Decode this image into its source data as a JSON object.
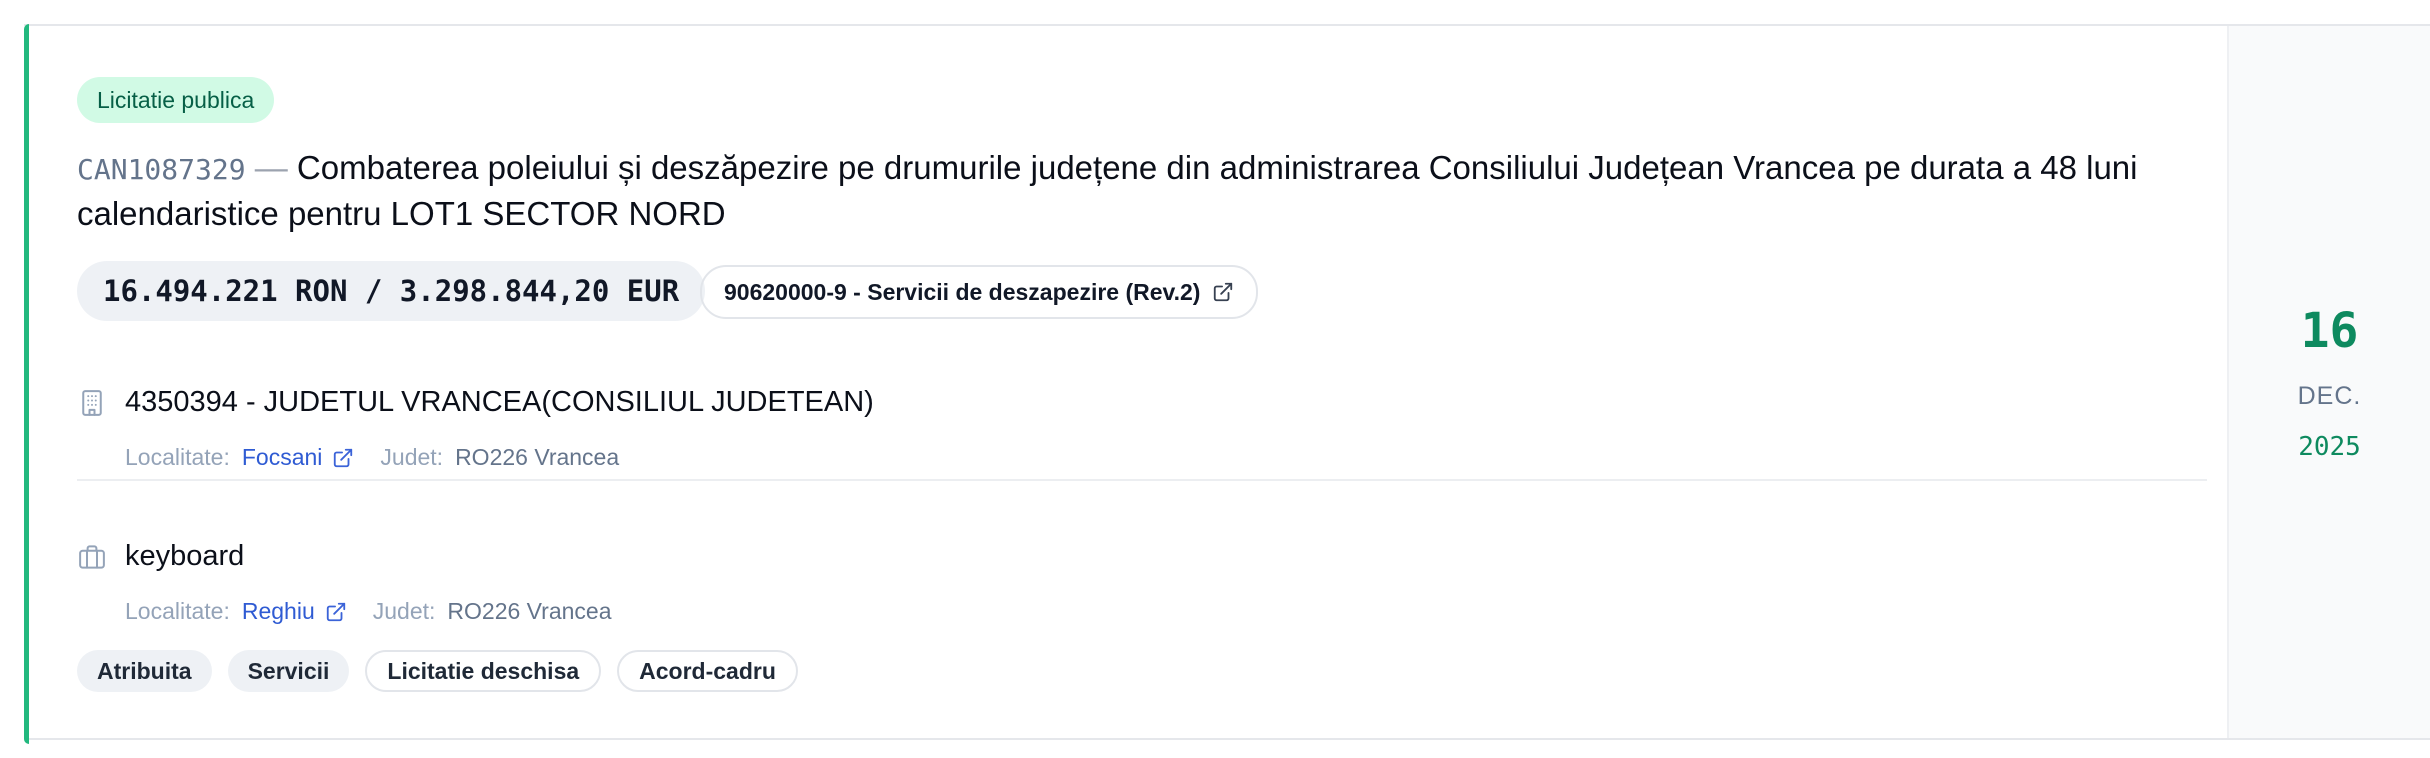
{
  "notice": {
    "type_badge": "Licitatie publica",
    "id": "CAN1087329",
    "separator": "—",
    "title": "Combaterea poleiului și deszăpezire pe drumurile județene din administrarea Consiliului Județean Vrancea pe durata a 48 luni calendaristice pentru LOT1 SECTOR NORD",
    "value": "16.494.221 RON / 3.298.844,20 EUR",
    "cpv": "90620000-9 - Servicii de deszapezire (Rev.2)"
  },
  "authority": {
    "icon": "building-icon",
    "name": "4350394 - JUDETUL VRANCEA(CONSILIUL JUDETEAN)",
    "locality_label": "Localitate:",
    "locality": "Focsani",
    "county_label": "Judet:",
    "county": "RO226 Vrancea"
  },
  "supplier": {
    "icon": "briefcase-icon",
    "name": "keyboard",
    "locality_label": "Localitate:",
    "locality": "Reghiu",
    "county_label": "Judet:",
    "county": "RO226 Vrancea"
  },
  "tags": [
    "Atribuita",
    "Servicii",
    "Licitatie deschisa",
    "Acord-cadru"
  ],
  "date": {
    "day": "16",
    "month": "DEC.",
    "year": "2025"
  },
  "colors": {
    "accent": "#22b87e",
    "badge_bg": "#d1fae5",
    "badge_text": "#065f46",
    "link": "#2f5bd3",
    "date_green": "#0e8a5f"
  }
}
